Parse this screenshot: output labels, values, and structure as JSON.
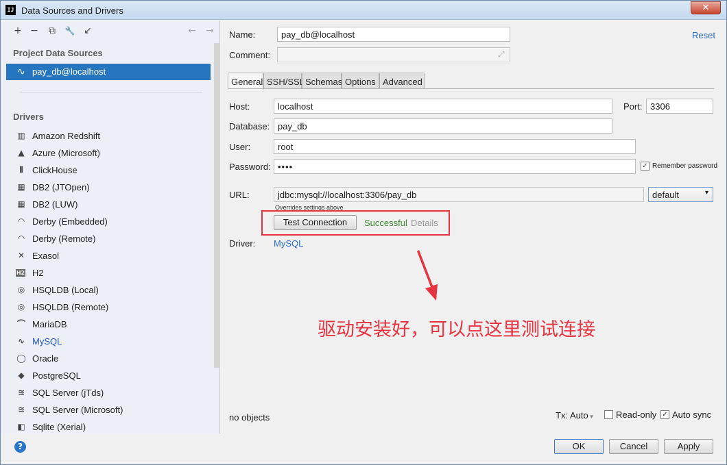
{
  "window": {
    "title": "Data Sources and Drivers",
    "app_icon_text": "IJ",
    "close_glyph": "✕"
  },
  "toolbar": {
    "add": "+",
    "remove": "−",
    "copy": "⧉",
    "edit": "🔧",
    "import": "↙",
    "back": "←",
    "forward": "→"
  },
  "left": {
    "project_section": "Project Data Sources",
    "data_source": "pay_db@localhost",
    "drivers_section": "Drivers",
    "drivers": [
      {
        "label": "Amazon Redshift",
        "icon": "redshift-icon",
        "glyph": "▥"
      },
      {
        "label": "Azure (Microsoft)",
        "icon": "azure-icon",
        "glyph": "▲"
      },
      {
        "label": "ClickHouse",
        "icon": "clickhouse-icon",
        "glyph": "⦀"
      },
      {
        "label": "DB2 (JTOpen)",
        "icon": "db2-icon",
        "glyph": "▦"
      },
      {
        "label": "DB2 (LUW)",
        "icon": "db2-icon",
        "glyph": "▦"
      },
      {
        "label": "Derby (Embedded)",
        "icon": "derby-icon",
        "glyph": "◠"
      },
      {
        "label": "Derby (Remote)",
        "icon": "derby-icon",
        "glyph": "◠"
      },
      {
        "label": "Exasol",
        "icon": "exasol-icon",
        "glyph": "✕"
      },
      {
        "label": "H2",
        "icon": "h2-icon",
        "glyph": "H2"
      },
      {
        "label": "HSQLDB (Local)",
        "icon": "hsqldb-icon",
        "glyph": "◎"
      },
      {
        "label": "HSQLDB (Remote)",
        "icon": "hsqldb-icon",
        "glyph": "◎"
      },
      {
        "label": "MariaDB",
        "icon": "mariadb-icon",
        "glyph": "⌒"
      },
      {
        "label": "MySQL",
        "icon": "mysql-icon",
        "glyph": "∿"
      },
      {
        "label": "Oracle",
        "icon": "oracle-icon",
        "glyph": "◯"
      },
      {
        "label": "PostgreSQL",
        "icon": "postgresql-icon",
        "glyph": "◆"
      },
      {
        "label": "SQL Server (jTds)",
        "icon": "sqlserver-icon",
        "glyph": "≋"
      },
      {
        "label": "SQL Server (Microsoft)",
        "icon": "sqlserver-icon",
        "glyph": "≋"
      },
      {
        "label": "Sqlite (Xerial)",
        "icon": "sqlite-icon",
        "glyph": "◧"
      }
    ],
    "help_glyph": "?"
  },
  "form": {
    "name_label": "Name:",
    "name_value": "pay_db@localhost",
    "reset_link": "Reset",
    "comment_label": "Comment:",
    "comment_value": "",
    "expand_glyph": "⤢",
    "tabs": [
      "General",
      "SSH/SSL",
      "Schemas",
      "Options",
      "Advanced"
    ],
    "host_label": "Host:",
    "host_value": "localhost",
    "port_label": "Port:",
    "port_value": "3306",
    "database_label": "Database:",
    "database_value": "pay_db",
    "user_label": "User:",
    "user_value": "root",
    "password_label": "Password:",
    "password_value": "••••",
    "remember_label": "Remember password",
    "remember_checked": true,
    "url_label": "URL:",
    "url_value": "jdbc:mysql://localhost:3306/pay_db",
    "url_hint": "Overrides settings above",
    "url_mode": "default",
    "test_button": "Test Connection",
    "test_status": "Successful",
    "details_link": "Details",
    "driver_label": "Driver:",
    "driver_value": "MySQL"
  },
  "annotation": {
    "text": "驱动安装好，可以点这里测试连接",
    "color": "#e5333f"
  },
  "footer": {
    "objects": "no objects",
    "tx": "Tx: Auto",
    "readonly": "Read-only",
    "readonly_checked": false,
    "autosync": "Auto sync",
    "autosync_checked": true,
    "ok": "OK",
    "cancel": "Cancel",
    "apply": "Apply"
  },
  "colors": {
    "selection": "#2675bf",
    "success": "#3a8a2e",
    "link": "#2a6bbf",
    "annotation": "#e5333f"
  }
}
